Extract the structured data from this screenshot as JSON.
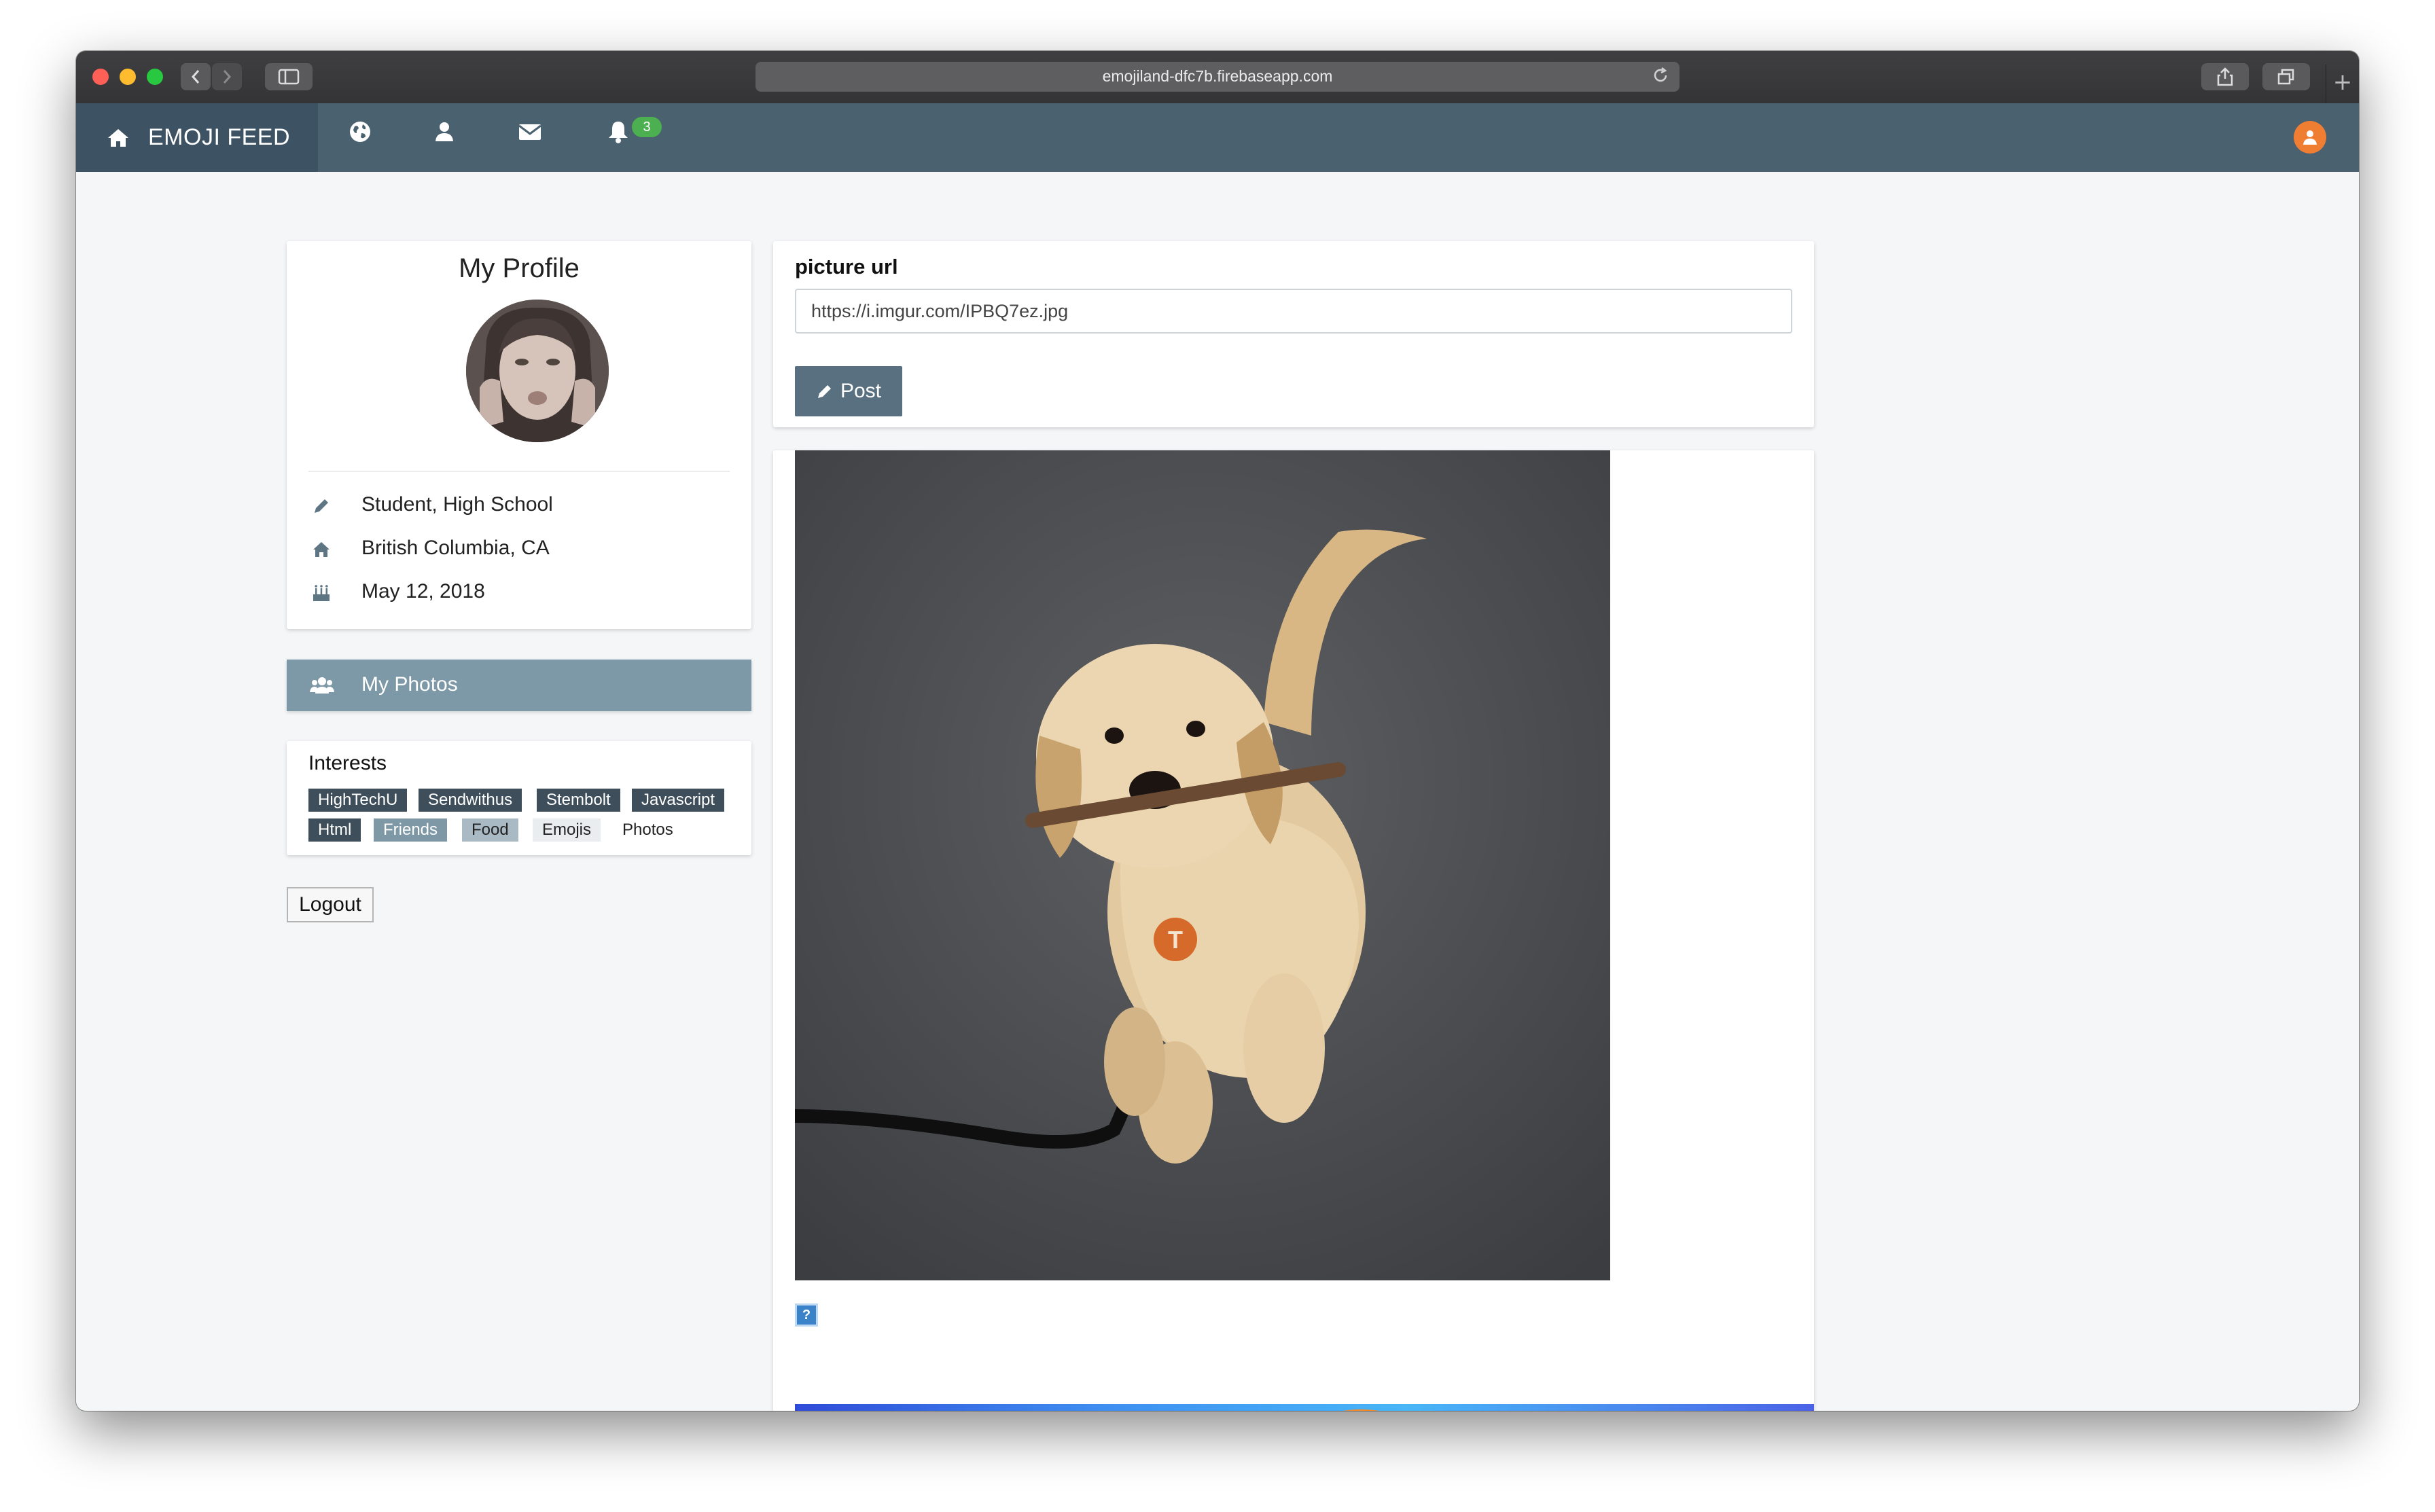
{
  "browser": {
    "url": "emojiland-dfc7b.firebaseapp.com"
  },
  "navbar": {
    "brand": "EMOJI FEED",
    "notification_count": "3"
  },
  "profile": {
    "title": "My Profile",
    "occupation": "Student, High School",
    "location": "British Columbia, CA",
    "birthday": "May 12, 2018"
  },
  "photos_button": {
    "label": "My Photos"
  },
  "interests": {
    "title": "Interests",
    "tags": [
      "HighTechU",
      "Sendwithus",
      "Stembolt",
      "Javascript",
      "Html",
      "Friends",
      "Food",
      "Emojis",
      "Photos"
    ]
  },
  "logout": {
    "label": "Logout"
  },
  "post_form": {
    "label": "picture url",
    "value": "https://i.imgur.com/IPBQ7ez.jpg",
    "button": "Post"
  },
  "broken_image_glyph": "?",
  "colors": {
    "navbar": "#4a6170",
    "brand_bg": "#3d5363",
    "photos_bar": "#7d98a6",
    "post_button": "#587080",
    "badge": "#4caf50",
    "avatar_accent": "#ef7d32"
  }
}
